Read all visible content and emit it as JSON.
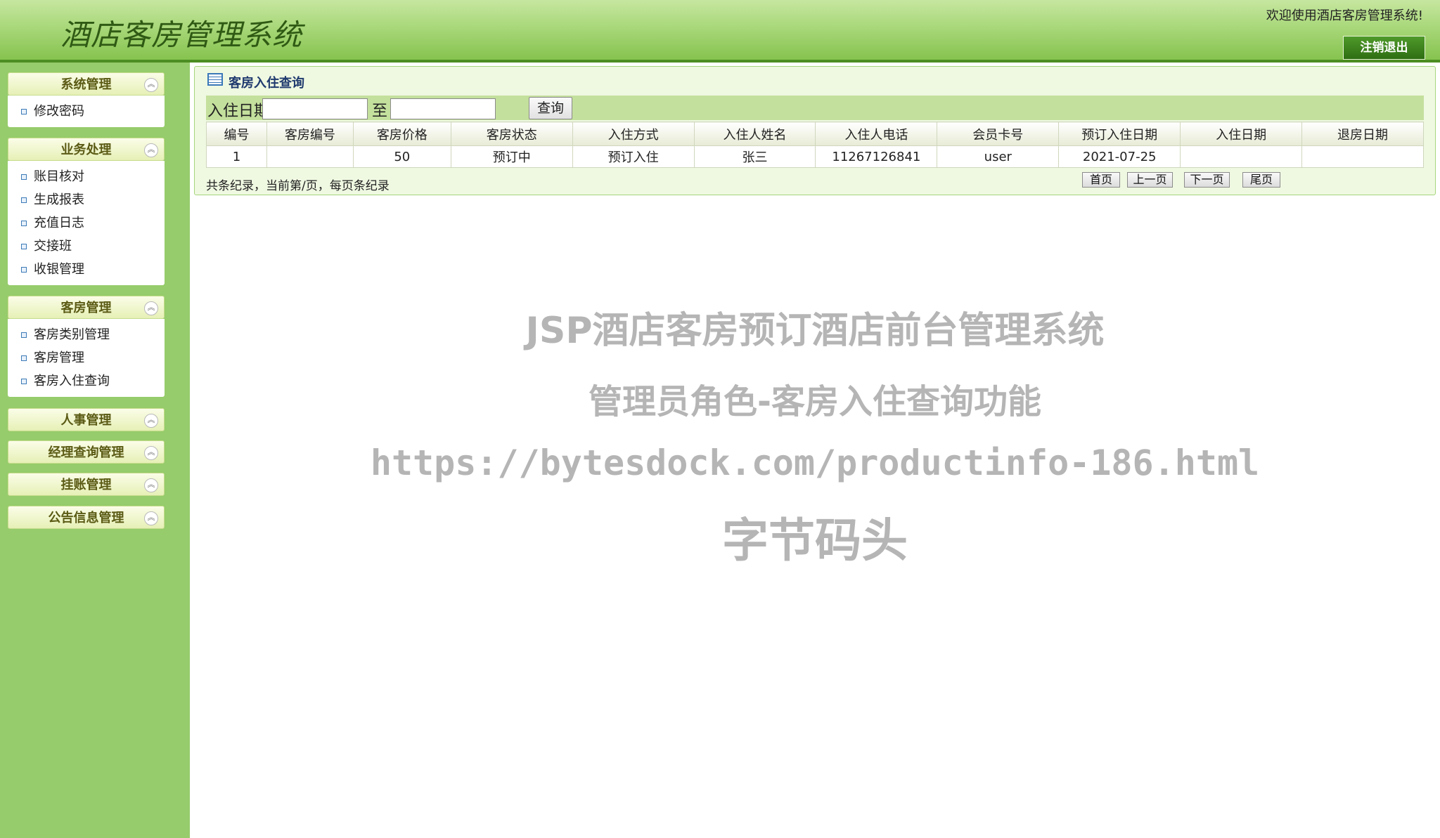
{
  "header": {
    "app_title": "酒店客房管理系统",
    "welcome_text": "欢迎使用酒店客房管理系统!",
    "logout_label": "注销退出"
  },
  "sidebar": {
    "groups": [
      {
        "title": "系统管理",
        "items": [
          "修改密码"
        ]
      },
      {
        "title": "业务处理",
        "items": [
          "账目核对",
          "生成报表",
          "充值日志",
          "交接班",
          "收银管理"
        ]
      },
      {
        "title": "客房管理",
        "items": [
          "客房类别管理",
          "客房管理",
          "客房入住查询"
        ]
      },
      {
        "title": "人事管理",
        "items": []
      },
      {
        "title": "经理查询管理",
        "items": []
      },
      {
        "title": "挂账管理",
        "items": []
      },
      {
        "title": "公告信息管理",
        "items": []
      }
    ]
  },
  "main": {
    "panel_title": "客房入住查询",
    "search": {
      "date_label": "入住日期",
      "to_label": "至",
      "from_value": "",
      "to_value": "",
      "query_label": "查询"
    },
    "table": {
      "columns": [
        "编号",
        "客房编号",
        "客房价格",
        "客房状态",
        "入住方式",
        "入住人姓名",
        "入住人电话",
        "会员卡号",
        "预订入住日期",
        "入住日期",
        "退房日期"
      ],
      "rows": [
        [
          "1",
          "",
          "50",
          "预订中",
          "预订入住",
          "张三",
          "11267126841",
          "user",
          "2021-07-25",
          "",
          ""
        ]
      ]
    },
    "pager": {
      "summary": "共条纪录，当前第/页，每页条纪录",
      "first": "首页",
      "prev": "上一页",
      "next": "下一页",
      "last": "尾页"
    }
  },
  "watermark": {
    "line1": "JSP酒店客房预订酒店前台管理系统",
    "line2": "管理员角色-客房入住查询功能",
    "line3": "https://bytesdock.com/productinfo-186.html",
    "line4": "字节码头"
  }
}
